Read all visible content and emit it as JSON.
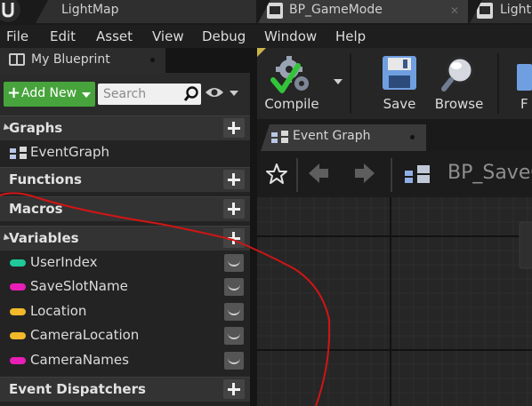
{
  "tabs": [
    {
      "label": "LightMap"
    },
    {
      "label": "BP_GameMode"
    },
    {
      "label": "Light"
    }
  ],
  "menu": [
    "File",
    "Edit",
    "Asset",
    "View",
    "Debug",
    "Window",
    "Help"
  ],
  "left_panel": {
    "tab_label": "My Blueprint",
    "add_new_label": "Add New",
    "search_placeholder": "Search",
    "sections": {
      "graphs": "Graphs",
      "functions": "Functions",
      "macros": "Macros",
      "variables": "Variables",
      "event_dispatchers": "Event Dispatchers"
    },
    "graph_items": [
      "EventGraph"
    ],
    "variables": [
      {
        "name": "UserIndex",
        "color": "#1fc99a"
      },
      {
        "name": "SaveSlotName",
        "color": "#e81fb6"
      },
      {
        "name": "Location",
        "color": "#f2b92a"
      },
      {
        "name": "CameraLocation",
        "color": "#f2b92a"
      },
      {
        "name": "CameraNames",
        "color": "#e81fb6"
      }
    ]
  },
  "toolbar": {
    "compile_label": "Compile",
    "save_label": "Save",
    "browse_label": "Browse",
    "partial_label": "F"
  },
  "graph_tab_label": "Event Graph",
  "graph_title": "BP_SaveG",
  "colors": {
    "add_new": "#47a43c",
    "annotation": "#d11515",
    "compile_check": "#33c43a"
  }
}
